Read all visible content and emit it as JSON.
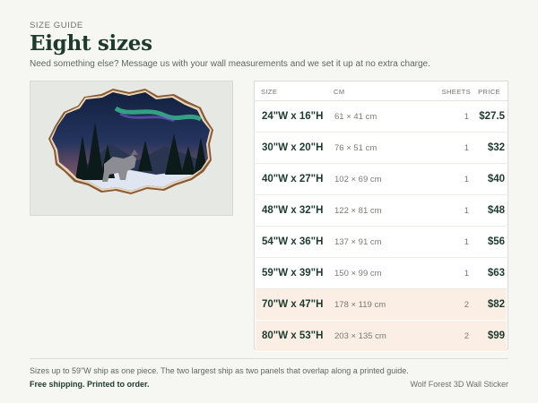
{
  "header": {
    "eyebrow": "SIZE GUIDE",
    "title": "Eight sizes",
    "subtitle": "Need something else? Message us with your wall measurements and we set it up at no extra charge."
  },
  "table": {
    "columns": {
      "size": "SIZE",
      "cm": "CM",
      "sheets": "SHEETS",
      "price": "PRICE"
    },
    "rows": [
      {
        "size": "24\"W x 16\"H",
        "cm": "61 × 41 cm",
        "sheets": "1",
        "price": "$27.5"
      },
      {
        "size": "30\"W x 20\"H",
        "cm": "76 × 51 cm",
        "sheets": "1",
        "price": "$32"
      },
      {
        "size": "40\"W x 27\"H",
        "cm": "102 × 69 cm",
        "sheets": "1",
        "price": "$40"
      },
      {
        "size": "48\"W x 32\"H",
        "cm": "122 × 81 cm",
        "sheets": "1",
        "price": "$48"
      },
      {
        "size": "54\"W x 36\"H",
        "cm": "137 × 91 cm",
        "sheets": "1",
        "price": "$56"
      },
      {
        "size": "59\"W x 39\"H",
        "cm": "150 × 99 cm",
        "sheets": "1",
        "price": "$63"
      },
      {
        "size": "70\"W x 47\"H",
        "cm": "178 × 119 cm",
        "sheets": "2",
        "price": "$82"
      },
      {
        "size": "80\"W x 53\"H",
        "cm": "203 × 135 cm",
        "sheets": "2",
        "price": "$99"
      }
    ],
    "highlight_color": "#fbeee4"
  },
  "footer": {
    "note": "Sizes up to 59\"W ship as one piece. The two largest ship as two panels that overlap along a printed guide.",
    "shipping": "Free shipping. Printed to order.",
    "product_name": "Wolf Forest 3D Wall Sticker"
  },
  "colors": {
    "accent": "#1e3a2f",
    "background": "#f6f6f3",
    "panel": "#e6e8e3"
  }
}
